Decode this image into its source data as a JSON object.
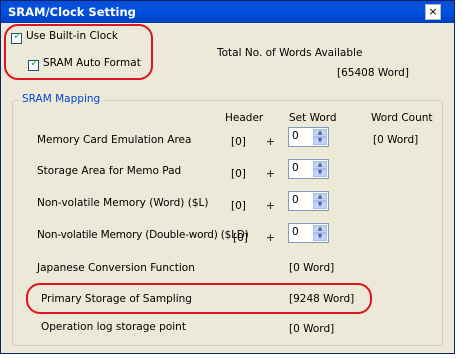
{
  "window": {
    "title": "SRAM/Clock Setting",
    "close_glyph": "×"
  },
  "options": {
    "use_clock": {
      "label": "Use Built-in Clock",
      "checked": true
    },
    "auto_format": {
      "label": "SRAM Auto Format",
      "checked": true
    }
  },
  "total_words": {
    "label": "Total No. of Words Available",
    "value": "[65408 Word]"
  },
  "mapping": {
    "title": "SRAM Mapping",
    "headers": {
      "header": "Header",
      "set_word": "Set Word",
      "word_count": "Word Count"
    },
    "plus": "+",
    "rows": [
      {
        "label": "Memory Card Emulation Area",
        "header": "[0]",
        "set_word": "0",
        "word_count": "[0 Word]"
      },
      {
        "label": "Storage Area for Memo Pad",
        "header": "[0]",
        "set_word": "0"
      },
      {
        "label": "Non-volatile Memory (Word) ($L)",
        "header": "[0]",
        "set_word": "0"
      },
      {
        "label": "Non-volatile Memory (Double-word) ($LD)",
        "header": "[0]",
        "set_word": "0"
      },
      {
        "label": "Japanese Conversion Function",
        "word_count": "[0 Word]"
      },
      {
        "label": "Primary Storage of Sampling",
        "word_count": "[9248 Word]"
      },
      {
        "label": "Operation log storage point",
        "word_count": "[0 Word]"
      }
    ]
  },
  "icons": {
    "check": "✓",
    "spin_up": "▲",
    "spin_down": "▼"
  },
  "colors": {
    "title_bar": "#0053e1",
    "dialog_bg": "#ece9d8",
    "highlight": "#e0141c",
    "group_label": "#0046d5"
  }
}
